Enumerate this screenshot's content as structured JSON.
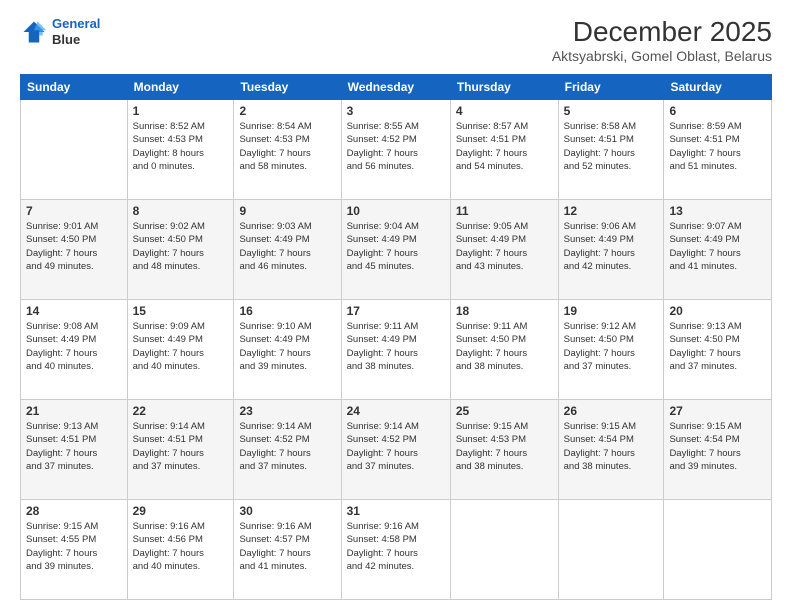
{
  "logo": {
    "line1": "General",
    "line2": "Blue"
  },
  "header": {
    "month": "December 2025",
    "location": "Aktsyabrski, Gomel Oblast, Belarus"
  },
  "weekdays": [
    "Sunday",
    "Monday",
    "Tuesday",
    "Wednesday",
    "Thursday",
    "Friday",
    "Saturday"
  ],
  "weeks": [
    [
      {
        "day": "",
        "info": ""
      },
      {
        "day": "1",
        "info": "Sunrise: 8:52 AM\nSunset: 4:53 PM\nDaylight: 8 hours\nand 0 minutes."
      },
      {
        "day": "2",
        "info": "Sunrise: 8:54 AM\nSunset: 4:53 PM\nDaylight: 7 hours\nand 58 minutes."
      },
      {
        "day": "3",
        "info": "Sunrise: 8:55 AM\nSunset: 4:52 PM\nDaylight: 7 hours\nand 56 minutes."
      },
      {
        "day": "4",
        "info": "Sunrise: 8:57 AM\nSunset: 4:51 PM\nDaylight: 7 hours\nand 54 minutes."
      },
      {
        "day": "5",
        "info": "Sunrise: 8:58 AM\nSunset: 4:51 PM\nDaylight: 7 hours\nand 52 minutes."
      },
      {
        "day": "6",
        "info": "Sunrise: 8:59 AM\nSunset: 4:51 PM\nDaylight: 7 hours\nand 51 minutes."
      }
    ],
    [
      {
        "day": "7",
        "info": "Sunrise: 9:01 AM\nSunset: 4:50 PM\nDaylight: 7 hours\nand 49 minutes."
      },
      {
        "day": "8",
        "info": "Sunrise: 9:02 AM\nSunset: 4:50 PM\nDaylight: 7 hours\nand 48 minutes."
      },
      {
        "day": "9",
        "info": "Sunrise: 9:03 AM\nSunset: 4:49 PM\nDaylight: 7 hours\nand 46 minutes."
      },
      {
        "day": "10",
        "info": "Sunrise: 9:04 AM\nSunset: 4:49 PM\nDaylight: 7 hours\nand 45 minutes."
      },
      {
        "day": "11",
        "info": "Sunrise: 9:05 AM\nSunset: 4:49 PM\nDaylight: 7 hours\nand 43 minutes."
      },
      {
        "day": "12",
        "info": "Sunrise: 9:06 AM\nSunset: 4:49 PM\nDaylight: 7 hours\nand 42 minutes."
      },
      {
        "day": "13",
        "info": "Sunrise: 9:07 AM\nSunset: 4:49 PM\nDaylight: 7 hours\nand 41 minutes."
      }
    ],
    [
      {
        "day": "14",
        "info": "Sunrise: 9:08 AM\nSunset: 4:49 PM\nDaylight: 7 hours\nand 40 minutes."
      },
      {
        "day": "15",
        "info": "Sunrise: 9:09 AM\nSunset: 4:49 PM\nDaylight: 7 hours\nand 40 minutes."
      },
      {
        "day": "16",
        "info": "Sunrise: 9:10 AM\nSunset: 4:49 PM\nDaylight: 7 hours\nand 39 minutes."
      },
      {
        "day": "17",
        "info": "Sunrise: 9:11 AM\nSunset: 4:49 PM\nDaylight: 7 hours\nand 38 minutes."
      },
      {
        "day": "18",
        "info": "Sunrise: 9:11 AM\nSunset: 4:50 PM\nDaylight: 7 hours\nand 38 minutes."
      },
      {
        "day": "19",
        "info": "Sunrise: 9:12 AM\nSunset: 4:50 PM\nDaylight: 7 hours\nand 37 minutes."
      },
      {
        "day": "20",
        "info": "Sunrise: 9:13 AM\nSunset: 4:50 PM\nDaylight: 7 hours\nand 37 minutes."
      }
    ],
    [
      {
        "day": "21",
        "info": "Sunrise: 9:13 AM\nSunset: 4:51 PM\nDaylight: 7 hours\nand 37 minutes."
      },
      {
        "day": "22",
        "info": "Sunrise: 9:14 AM\nSunset: 4:51 PM\nDaylight: 7 hours\nand 37 minutes."
      },
      {
        "day": "23",
        "info": "Sunrise: 9:14 AM\nSunset: 4:52 PM\nDaylight: 7 hours\nand 37 minutes."
      },
      {
        "day": "24",
        "info": "Sunrise: 9:14 AM\nSunset: 4:52 PM\nDaylight: 7 hours\nand 37 minutes."
      },
      {
        "day": "25",
        "info": "Sunrise: 9:15 AM\nSunset: 4:53 PM\nDaylight: 7 hours\nand 38 minutes."
      },
      {
        "day": "26",
        "info": "Sunrise: 9:15 AM\nSunset: 4:54 PM\nDaylight: 7 hours\nand 38 minutes."
      },
      {
        "day": "27",
        "info": "Sunrise: 9:15 AM\nSunset: 4:54 PM\nDaylight: 7 hours\nand 39 minutes."
      }
    ],
    [
      {
        "day": "28",
        "info": "Sunrise: 9:15 AM\nSunset: 4:55 PM\nDaylight: 7 hours\nand 39 minutes."
      },
      {
        "day": "29",
        "info": "Sunrise: 9:16 AM\nSunset: 4:56 PM\nDaylight: 7 hours\nand 40 minutes."
      },
      {
        "day": "30",
        "info": "Sunrise: 9:16 AM\nSunset: 4:57 PM\nDaylight: 7 hours\nand 41 minutes."
      },
      {
        "day": "31",
        "info": "Sunrise: 9:16 AM\nSunset: 4:58 PM\nDaylight: 7 hours\nand 42 minutes."
      },
      {
        "day": "",
        "info": ""
      },
      {
        "day": "",
        "info": ""
      },
      {
        "day": "",
        "info": ""
      }
    ]
  ]
}
